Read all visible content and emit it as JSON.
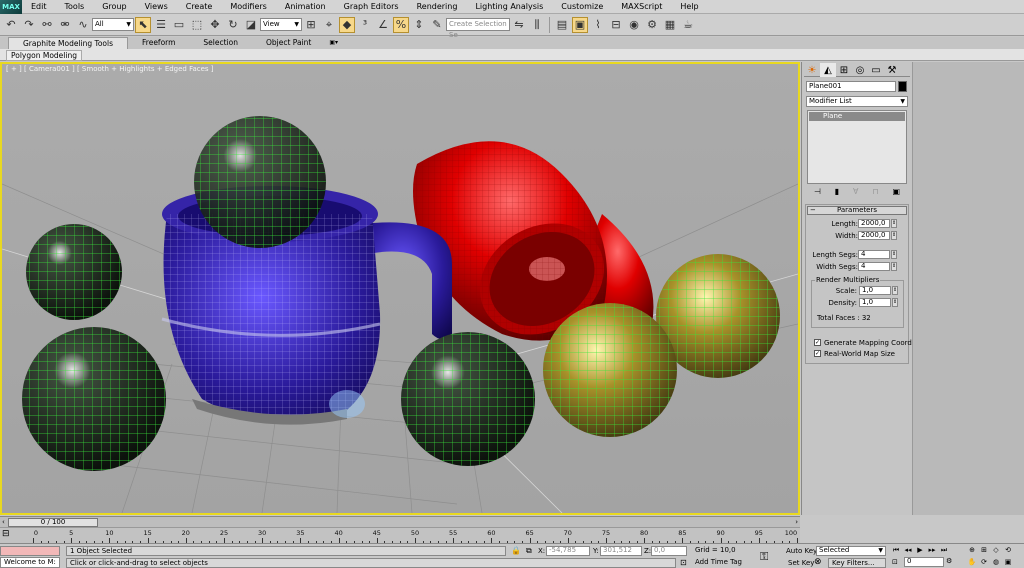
{
  "app": {
    "logo": "MAX"
  },
  "menu": [
    "Edit",
    "Tools",
    "Group",
    "Views",
    "Create",
    "Modifiers",
    "Animation",
    "Graph Editors",
    "Rendering",
    "Lighting Analysis",
    "Customize",
    "MAXScript",
    "Help"
  ],
  "toolbar": {
    "selection_filter": "All",
    "ref_coord": "View",
    "named_selection_placeholder": "Create Selection Se"
  },
  "ribbon": {
    "tabs": [
      "Graphite Modeling Tools",
      "Freeform",
      "Selection",
      "Object Paint"
    ],
    "panel_label": "Polygon Modeling"
  },
  "viewport": {
    "label": "[ + ] [ Camera001 ] [ Smooth + Highlights + Edged Faces ]"
  },
  "command_panel": {
    "object_name": "Plane001",
    "modifier_list": "Modifier List",
    "stack_item": "Plane",
    "rollout_title": "Parameters",
    "length_label": "Length:",
    "length_value": "2000,0",
    "width_label": "Width:",
    "width_value": "2000,0",
    "length_segs_label": "Length Segs:",
    "length_segs_value": "4",
    "width_segs_label": "Width Segs:",
    "width_segs_value": "4",
    "render_multipliers_label": "Render Multipliers",
    "scale_label": "Scale:",
    "scale_value": "1,0",
    "density_label": "Density:",
    "density_value": "1,0",
    "total_faces": "Total Faces : 32",
    "gen_mapping": "Generate Mapping Coords.",
    "real_world": "Real-World Map Size"
  },
  "timeline": {
    "frame_display": "0 / 100",
    "tick_labels": [
      "0",
      "5",
      "10",
      "15",
      "20",
      "25",
      "30",
      "35",
      "40",
      "45",
      "50",
      "55",
      "60",
      "65",
      "70",
      "75",
      "80",
      "85",
      "90",
      "95",
      "100"
    ]
  },
  "status": {
    "maxscript": "Welcome to M:",
    "selection": "1 Object Selected",
    "prompt": "Click or click-and-drag to select objects",
    "x_label": "X:",
    "x_value": "-54,785",
    "y_label": "Y:",
    "y_value": "301,512",
    "z_label": "Z:",
    "z_value": "0,0",
    "grid": "Grid = 10,0",
    "add_time_tag": "Add Time Tag",
    "auto_key": "Auto Key",
    "set_key": "Set Key",
    "selected": "Selected",
    "key_filters": "Key Filters...",
    "frame": "0"
  },
  "colors": {
    "viewport_border": "#e8d820",
    "active_icon": "#f7d88a"
  }
}
